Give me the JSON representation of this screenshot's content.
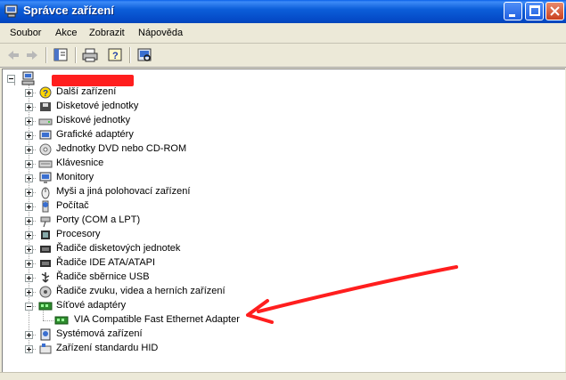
{
  "window": {
    "title": "Správce zařízení",
    "icon": "computer-management-icon"
  },
  "menu": [
    "Soubor",
    "Akce",
    "Zobrazit",
    "Nápověda"
  ],
  "toolbar": [
    "back-arrow-icon",
    "forward-arrow-icon",
    "properties-pane-icon",
    "print-icon",
    "help-icon",
    "scan-hardware-icon"
  ],
  "tree": {
    "root": {
      "label": "",
      "icon": "computer-icon",
      "redacted": true
    },
    "categories": [
      {
        "label": "Další zařízení",
        "icon": "unknown-device-icon"
      },
      {
        "label": "Disketové jednotky",
        "icon": "floppy-icon"
      },
      {
        "label": "Diskové jednotky",
        "icon": "disk-drive-icon"
      },
      {
        "label": "Grafické adaptéry",
        "icon": "display-adapter-icon"
      },
      {
        "label": "Jednotky DVD nebo CD-ROM",
        "icon": "cdrom-icon"
      },
      {
        "label": "Klávesnice",
        "icon": "keyboard-icon"
      },
      {
        "label": "Monitory",
        "icon": "monitor-icon"
      },
      {
        "label": "Myši a jiná polohovací zařízení",
        "icon": "mouse-icon"
      },
      {
        "label": "Počítač",
        "icon": "computer-small-icon"
      },
      {
        "label": "Porty (COM a LPT)",
        "icon": "port-icon"
      },
      {
        "label": "Procesory",
        "icon": "processor-icon"
      },
      {
        "label": "Řadiče disketových jednotek",
        "icon": "floppy-controller-icon"
      },
      {
        "label": "Řadiče IDE ATA/ATAPI",
        "icon": "ide-controller-icon"
      },
      {
        "label": "Řadiče sběrnice USB",
        "icon": "usb-icon"
      },
      {
        "label": "Řadiče zvuku, videa a herních zařízení",
        "icon": "sound-icon"
      },
      {
        "label": "Síťové adaptéry",
        "icon": "network-adapter-icon",
        "expanded": true,
        "children": [
          {
            "label": "VIA Compatible Fast Ethernet Adapter",
            "icon": "network-card-icon"
          }
        ]
      },
      {
        "label": "Systémová zařízení",
        "icon": "system-device-icon"
      },
      {
        "label": "Zařízení standardu HID",
        "icon": "hid-icon"
      }
    ]
  },
  "annotation": {
    "type": "red-arrow",
    "color": "#ff1e1e",
    "points_to": "VIA Compatible Fast Ethernet Adapter"
  },
  "colors": {
    "titlebar": "#0c5ed9",
    "chrome": "#ece9d8",
    "arrow": "#ff1e1e"
  }
}
